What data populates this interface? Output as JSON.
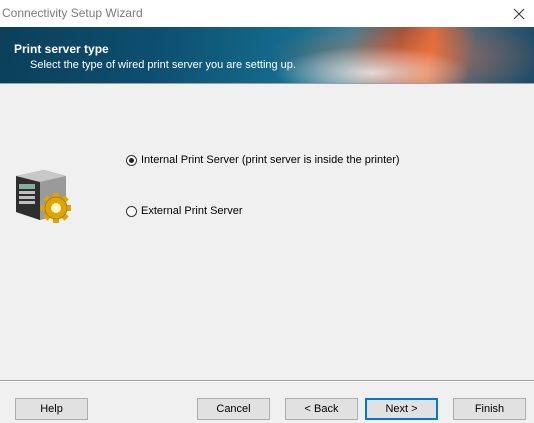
{
  "window": {
    "title": "Connectivity Setup Wizard",
    "close_icon": "close-icon"
  },
  "banner": {
    "heading": "Print server type",
    "subheading": "Select the type of wired print server you are setting up."
  },
  "icon": {
    "name": "print-server-gear-icon"
  },
  "options": [
    {
      "label": "Internal Print Server (print server is inside the printer)",
      "selected": true
    },
    {
      "label": "External Print Server",
      "selected": false
    }
  ],
  "buttons": {
    "help": "Help",
    "cancel": "Cancel",
    "back": "< Back",
    "next": "Next >",
    "finish": "Finish"
  },
  "colors": {
    "accent": "#0078d7",
    "dialog_bg": "#f0f0f0"
  }
}
